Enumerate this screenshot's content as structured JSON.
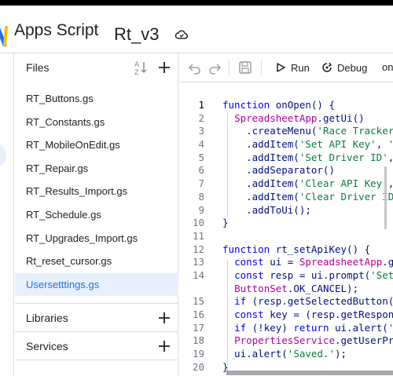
{
  "app": {
    "name": "Apps Script",
    "project": "Rt_v3"
  },
  "icons": {
    "logo": "apps-script-logo",
    "cloud": "cloud-sync-icon",
    "sort": "sort-az-icon",
    "add": "plus-icon",
    "undo": "undo-icon",
    "redo": "redo-icon",
    "save": "save-icon",
    "run": "play-icon",
    "debug": "debug-icon"
  },
  "files_panel": {
    "title": "Files",
    "files": [
      "RT_Buttons.gs",
      "RT_Constants.gs",
      "RT_MobileOnEdit.gs",
      "RT_Repair.gs",
      "RT_Results_Import.gs",
      "RT_Schedule.gs",
      "RT_Upgrades_Import.gs",
      "Rt_reset_cursor.gs",
      "Usersetttings.gs"
    ],
    "selected_index": 8,
    "sections": [
      "Libraries",
      "Services"
    ]
  },
  "toolbar": {
    "run_label": "Run",
    "debug_label": "Debug",
    "function_label": "on"
  },
  "editor": {
    "active_line": 1,
    "lines": [
      {
        "n": "1",
        "tokens": [
          [
            "kw",
            "function "
          ],
          [
            "plain",
            "onOpen() {"
          ]
        ]
      },
      {
        "n": "2",
        "tokens": [
          [
            "plain",
            "  "
          ],
          [
            "cls",
            "SpreadsheetApp"
          ],
          [
            "plain",
            ".getUi()"
          ]
        ]
      },
      {
        "n": "3",
        "tokens": [
          [
            "plain",
            "    .createMenu("
          ],
          [
            "str",
            "'Race Tracker'"
          ]
        ]
      },
      {
        "n": "4",
        "tokens": [
          [
            "plain",
            "    .addItem("
          ],
          [
            "str",
            "'Set API Key'"
          ],
          [
            "plain",
            ", "
          ],
          [
            "str",
            "'r"
          ]
        ]
      },
      {
        "n": "5",
        "tokens": [
          [
            "plain",
            "    .addItem("
          ],
          [
            "str",
            "'Set Driver ID'"
          ],
          [
            "plain",
            ","
          ]
        ]
      },
      {
        "n": "6",
        "tokens": [
          [
            "plain",
            "    .addSeparator()"
          ]
        ]
      },
      {
        "n": "7",
        "tokens": [
          [
            "plain",
            "    .addItem("
          ],
          [
            "str",
            "'Clear API Key'"
          ],
          [
            "plain",
            ","
          ]
        ]
      },
      {
        "n": "8",
        "tokens": [
          [
            "plain",
            "    .addItem("
          ],
          [
            "str",
            "'Clear Driver ID'"
          ]
        ]
      },
      {
        "n": "9",
        "tokens": [
          [
            "plain",
            "    .addToUi();"
          ]
        ]
      },
      {
        "n": "10",
        "tokens": [
          [
            "plain",
            "}"
          ]
        ]
      },
      {
        "n": "11",
        "tokens": []
      },
      {
        "n": "12",
        "tokens": [
          [
            "kw",
            "function "
          ],
          [
            "plain",
            "rt_setApiKey() {"
          ]
        ]
      },
      {
        "n": "13",
        "tokens": [
          [
            "plain",
            "  "
          ],
          [
            "kw",
            "const "
          ],
          [
            "plain",
            "ui = "
          ],
          [
            "cls",
            "SpreadsheetApp"
          ],
          [
            "plain",
            ".ge"
          ]
        ]
      },
      {
        "n": "14",
        "tokens": [
          [
            "plain",
            "  "
          ],
          [
            "kw",
            "const "
          ],
          [
            "plain",
            "resp = ui.prompt("
          ],
          [
            "str",
            "'Set "
          ]
        ]
      },
      {
        "n": "",
        "tokens": [
          [
            "plain",
            "  "
          ],
          [
            "cls",
            "ButtonSet"
          ],
          [
            "plain",
            ".OK_CANCEL);"
          ]
        ]
      },
      {
        "n": "15",
        "tokens": [
          [
            "plain",
            "  "
          ],
          [
            "kw",
            "if "
          ],
          [
            "plain",
            "(resp.getSelectedButton()"
          ]
        ]
      },
      {
        "n": "16",
        "tokens": [
          [
            "plain",
            "  "
          ],
          [
            "kw",
            "const "
          ],
          [
            "plain",
            "key = (resp.getRespons"
          ]
        ]
      },
      {
        "n": "17",
        "tokens": [
          [
            "plain",
            "  "
          ],
          [
            "kw",
            "if "
          ],
          [
            "plain",
            "(!key) "
          ],
          [
            "kw",
            "return "
          ],
          [
            "plain",
            "ui.alert("
          ],
          [
            "str",
            "'N"
          ]
        ]
      },
      {
        "n": "18",
        "tokens": [
          [
            "plain",
            "  "
          ],
          [
            "cls",
            "PropertiesService"
          ],
          [
            "plain",
            ".getUserPro"
          ]
        ]
      },
      {
        "n": "19",
        "tokens": [
          [
            "plain",
            "  ui.alert("
          ],
          [
            "str",
            "'Saved.'"
          ],
          [
            "plain",
            ");"
          ]
        ]
      },
      {
        "n": "20",
        "tokens": [
          [
            "plain",
            "}"
          ]
        ]
      }
    ]
  }
}
